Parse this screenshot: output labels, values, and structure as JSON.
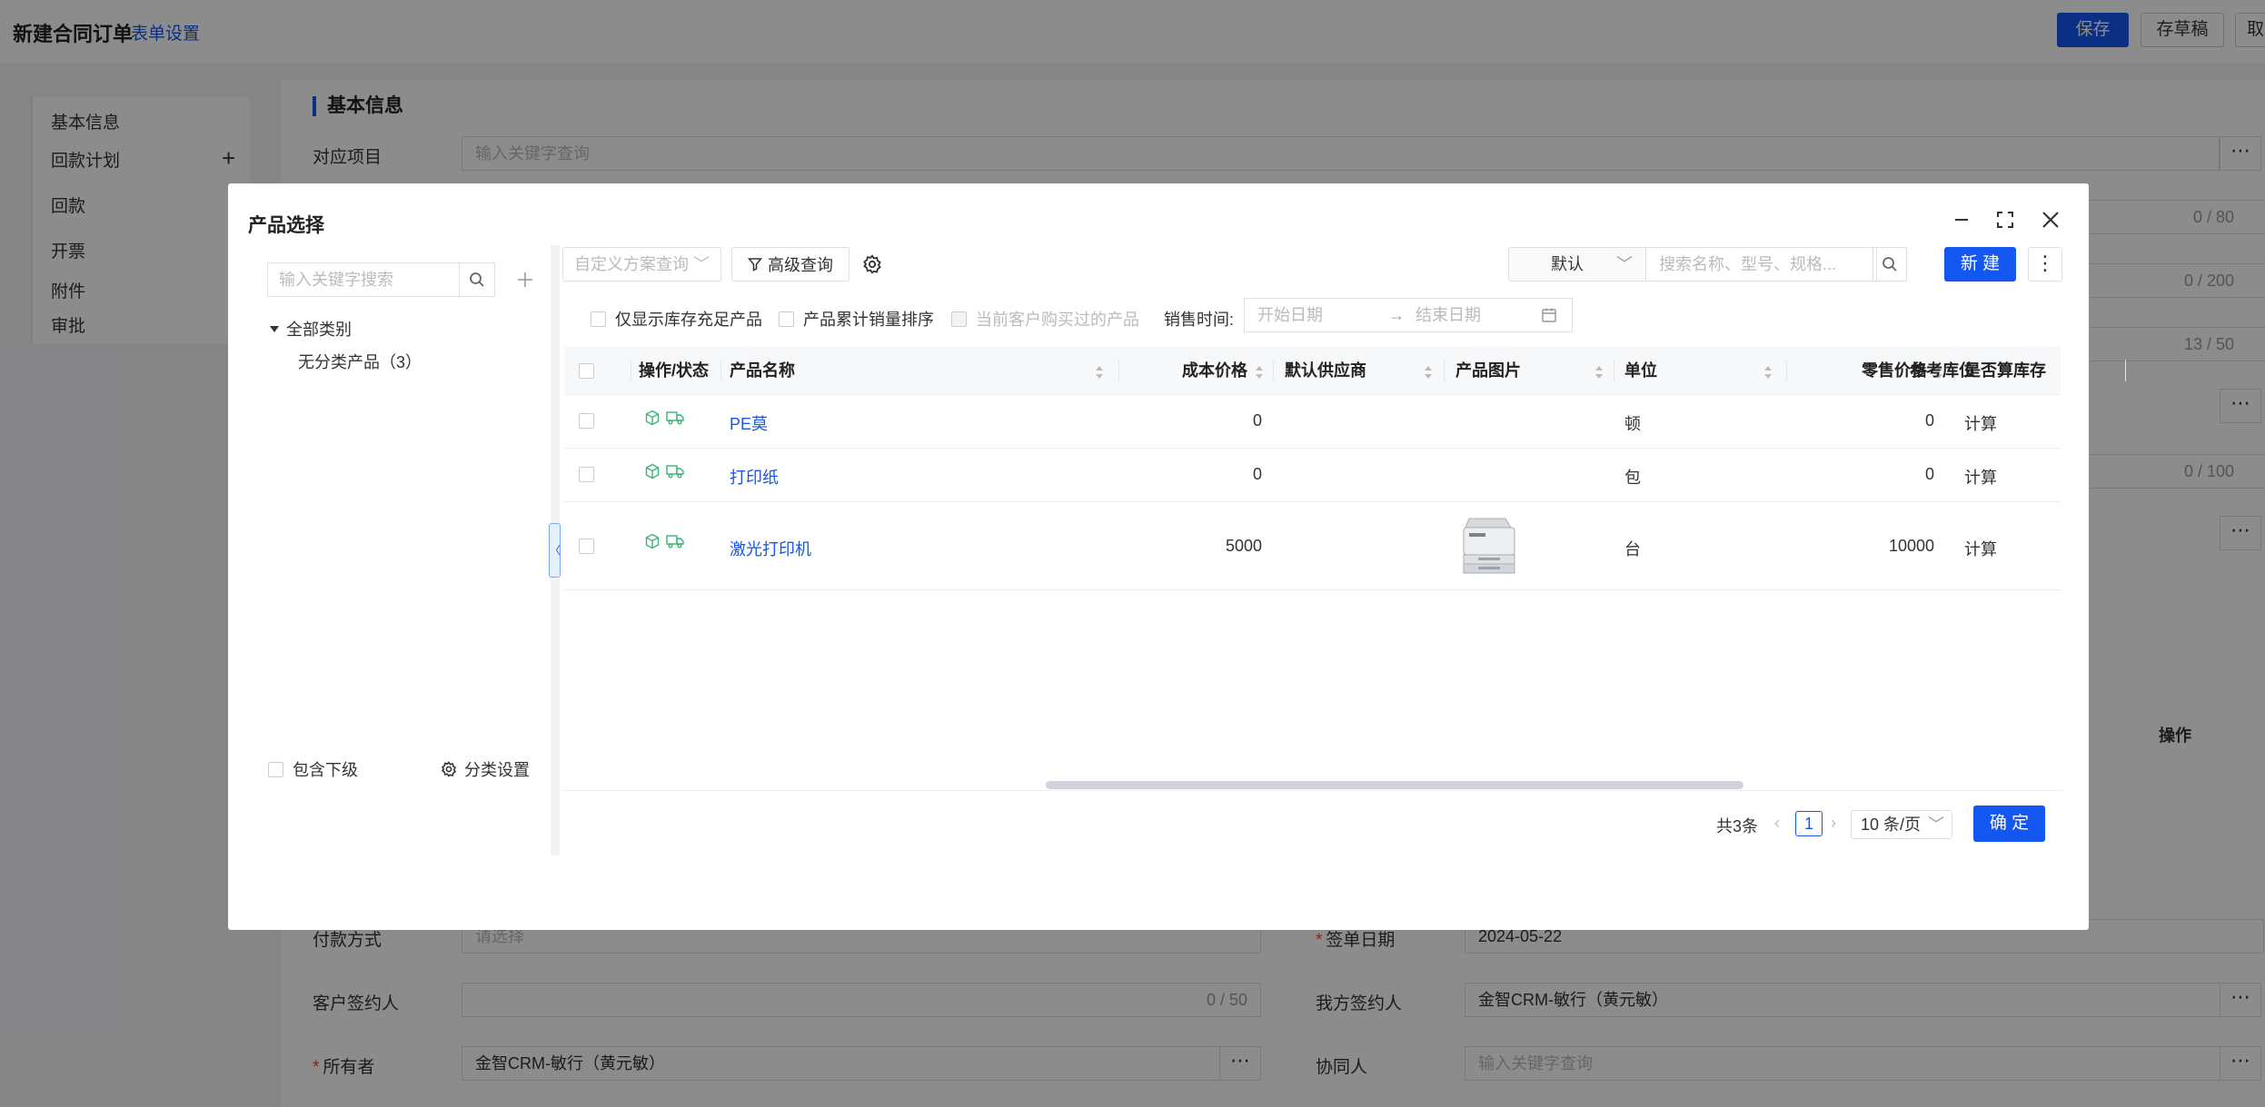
{
  "page": {
    "title": "新建合同订单",
    "form_setting": "表单设置",
    "save_label": "保存",
    "draft_label": "存草稿",
    "cancel_label": "取"
  },
  "nav": {
    "items": [
      "基本信息",
      "回款计划",
      "回款",
      "开票",
      "附件",
      "审批"
    ]
  },
  "background_form": {
    "section_title": "基本信息",
    "project_label": "对应项目",
    "project_placeholder": "输入关键字查询",
    "counters": [
      "0 / 80",
      "0 / 200",
      "13 / 50",
      "0 / 100"
    ],
    "payment_method_label": "付款方式",
    "payment_method_placeholder": "请选择",
    "sign_date_label": "签单日期",
    "sign_date_value": "2024-05-22",
    "customer_signer_label": "客户签约人",
    "customer_signer_counter": "0 / 50",
    "our_signer_label": "我方签约人",
    "our_signer_value": "金智CRM-敏行（黄元敏）",
    "owner_label": "所有者",
    "owner_value": "金智CRM-敏行（黄元敏）",
    "collaborator_label": "协同人",
    "collaborator_placeholder": "输入关键字查询",
    "action_header": "操作"
  },
  "modal": {
    "title": "产品选择",
    "sidebar": {
      "search_placeholder": "输入关键字搜索",
      "tree_root": "全部类别",
      "tree_child": "无分类产品（3）",
      "include_sub": "包含下级",
      "category_setting": "分类设置"
    },
    "toolbar": {
      "scheme_placeholder": "自定义方案查询",
      "advanced_query": "高级查询",
      "sort_value": "默认",
      "search_placeholder": "搜索名称、型号、规格...",
      "new_label": "新 建"
    },
    "filters": {
      "stock_only": "仅显示库存充足产品",
      "sales_sort": "产品累计销量排序",
      "bought_by_customer": "当前客户购买过的产品",
      "sale_time_label": "销售时间:",
      "start_date": "开始日期",
      "end_date": "结束日期"
    },
    "table": {
      "headers": [
        "操作/状态",
        "产品名称",
        "成本价格",
        "默认供应商",
        "产品图片",
        "单位",
        "零售价格",
        "是否算库存",
        "参考库位"
      ],
      "rows": [
        {
          "name": "PE莫",
          "cost": "0",
          "supplier": "",
          "unit": "顿",
          "retail": "0",
          "stock": "计算",
          "location": ""
        },
        {
          "name": "打印纸",
          "cost": "0",
          "supplier": "",
          "unit": "包",
          "retail": "0",
          "stock": "计算",
          "location": ""
        },
        {
          "name": "激光打印机",
          "cost": "5000",
          "supplier": "",
          "unit": "台",
          "retail": "10000",
          "stock": "计算",
          "location": ""
        }
      ]
    },
    "pagination": {
      "total": "共3条",
      "current_page": "1",
      "page_size": "10 条/页"
    },
    "confirm_label": "确 定"
  },
  "colors": {
    "primary": "#1456f0",
    "required": "#e54545",
    "status_icon": "#3cb371"
  },
  "icons": [
    "search-icon",
    "plus-icon",
    "filter-icon",
    "gear-icon",
    "minimize-icon",
    "maximize-icon",
    "close-icon",
    "more-icon",
    "calendar-icon",
    "box-icon",
    "truck-icon"
  ]
}
